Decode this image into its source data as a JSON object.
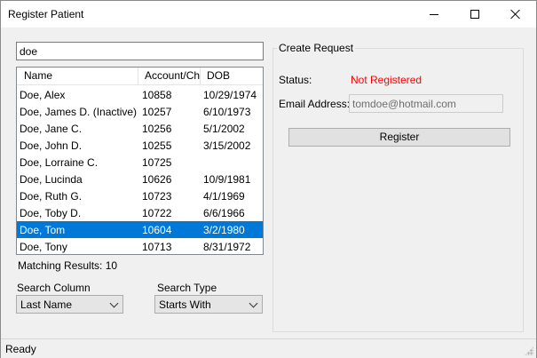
{
  "window": {
    "title": "Register Patient"
  },
  "search": {
    "value": "doe"
  },
  "table": {
    "columns": [
      "Name",
      "Account/Chart",
      "DOB"
    ],
    "rows": [
      {
        "name": "Doe, Alex",
        "account": "10858",
        "dob": "10/29/1974",
        "selected": false
      },
      {
        "name": "Doe, James D. (Inactive)",
        "account": "10257",
        "dob": "6/10/1973",
        "selected": false
      },
      {
        "name": "Doe, Jane C.",
        "account": "10256",
        "dob": "5/1/2002",
        "selected": false
      },
      {
        "name": "Doe, John D.",
        "account": "10255",
        "dob": "3/15/2002",
        "selected": false
      },
      {
        "name": "Doe, Lorraine C.",
        "account": "10725",
        "dob": "",
        "selected": false
      },
      {
        "name": "Doe, Lucinda",
        "account": "10626",
        "dob": "10/9/1981",
        "selected": false
      },
      {
        "name": "Doe, Ruth G.",
        "account": "10723",
        "dob": "4/1/1969",
        "selected": false
      },
      {
        "name": "Doe, Toby D.",
        "account": "10722",
        "dob": "6/6/1966",
        "selected": false
      },
      {
        "name": "Doe, Tom",
        "account": "10604",
        "dob": "3/2/1980",
        "selected": true
      },
      {
        "name": "Doe, Tony",
        "account": "10713",
        "dob": "8/31/1972",
        "selected": false
      }
    ],
    "selected_color": "#0078d7"
  },
  "matching": {
    "text": "Matching Results: 10"
  },
  "search_column": {
    "label": "Search Column",
    "value": "Last Name"
  },
  "search_type": {
    "label": "Search Type",
    "value": "Starts With"
  },
  "request": {
    "group_title": "Create Request",
    "status_label": "Status:",
    "status_value": "Not Registered",
    "status_color": "#ff0000",
    "email_label": "Email Address:",
    "email_value": "tomdoe@hotmail.com",
    "register_label": "Register"
  },
  "statusbar": {
    "text": "Ready"
  },
  "icons": {
    "minimize": "minimize-icon",
    "maximize": "maximize-icon",
    "close": "close-icon",
    "dropdown": "chevron-down-icon",
    "grip": "resize-grip-icon"
  }
}
